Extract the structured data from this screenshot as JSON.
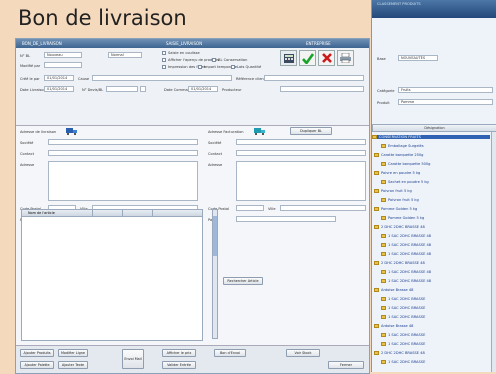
{
  "page": {
    "title": "Bon de livraison"
  },
  "main_window": {
    "title_left": "BON_DE_LIVRAISON",
    "title_mid": "SAISIE_LIVRAISON",
    "title_right": "ENTREPRISE",
    "fields": {
      "num_label": "N° BL",
      "num_value": "Nouveau",
      "modifie_label": "Modifié par",
      "cree_label": "Créé le par",
      "cree_value": "01/01/2014",
      "dateliv_label": "Date Livraison",
      "dateliv_value": "01/01/2014",
      "cause_label": "Cause",
      "num_bl_label": "N° Devis/BL",
      "ref_client_label": "Référence client",
      "date_cmd_label": "Date Commande",
      "date_cmd_value": "01/01/2014",
      "producteur_label": "Producteur",
      "statut_value": "Normal"
    },
    "checkboxes": [
      "Saisie en coulisse",
      "Afficher l'aperçu de produits",
      "BL Conservation",
      "Impression des frites",
      "Import temporaire",
      "Lots Quantité"
    ],
    "tabs": [
      "Entête",
      "Lignes",
      "Pied"
    ],
    "left_section": {
      "heading": "Adresse de livraison",
      "societe": "Société",
      "contact": "Contact",
      "adresse": "Adresse",
      "code_postal": "Code Postal",
      "ville": "Ville",
      "pays": "Pays",
      "sans_impr": "Si impression"
    },
    "right_section": {
      "heading": "Adresse Facturation",
      "button": "Dupliquer BL",
      "societe": "Société",
      "contact": "Contact",
      "adresse": "Adresse",
      "code_postal": "Code Postal",
      "ville": "Ville",
      "pays": "Pays"
    },
    "grid_header": "Nom de l'article",
    "side_button": "Rechercher Article",
    "bottom_buttons": [
      "Ajouter Produits",
      "Modifier Ligne",
      "Ajouter Palette",
      "Ajouter Texte",
      "Envoi Mail",
      "Afficher le prix",
      "Valider Entrée",
      "Bon d'Envoi",
      "Voir Stock",
      "Fermer"
    ],
    "toolbar_icons": [
      "calculator-icon",
      "check-icon",
      "delete-icon",
      "print-icon"
    ],
    "colors": {
      "accent": "#2f62b3",
      "check": "#1aa32a",
      "delete": "#cc1a1a"
    }
  },
  "side_window": {
    "title": "CLASSEMENT PRODUITS",
    "fields": {
      "base_label": "Base",
      "base_value": "NOUVEAUTÉS",
      "categorie_label": "Catégorie",
      "categorie_value": "Fruits",
      "produit_label": "Produit",
      "produit_value": "Pomme"
    },
    "list_header": "Désignation",
    "tree": [
      {
        "label": "CONSERVATION FRUITS",
        "level": 0,
        "selected": true
      },
      {
        "label": "Emballage Surgelés",
        "level": 1
      },
      {
        "label": "Carotte barquette 250g",
        "level": 0
      },
      {
        "label": "Carotte barquette 500g",
        "level": 1
      },
      {
        "label": "Poivre en poudre 5 kg",
        "level": 0
      },
      {
        "label": "Sachet en poudre 5 kg",
        "level": 1
      },
      {
        "label": "Poivron fruit 5 kg",
        "level": 0
      },
      {
        "label": "Poivron fruit 5 kg",
        "level": 1
      },
      {
        "label": "Pomme Golden 5 kg",
        "level": 0
      },
      {
        "label": "Pomme Golden 5 kg",
        "level": 1
      },
      {
        "label": "2 DHC 2DHC BRASSE 48",
        "level": 0
      },
      {
        "label": "1 SAC 2DHC BRASSE 48",
        "level": 1
      },
      {
        "label": "1 SAC 2DHC BRASSE 48",
        "level": 1
      },
      {
        "label": "1 SAC 2DHC BRASSE 48",
        "level": 1
      },
      {
        "label": "2 DHC 2DHC BRASSE 48",
        "level": 0
      },
      {
        "label": "1 SAC 2DHC BRASSE 48",
        "level": 1
      },
      {
        "label": "1 SAC 2DHC BRASSE 48",
        "level": 1
      },
      {
        "label": "Ardoise Brasse 48",
        "level": 0
      },
      {
        "label": "1 SAC 2DHC BRASSE",
        "level": 1
      },
      {
        "label": "1 SAC 2DHC BRASSE",
        "level": 1
      },
      {
        "label": "1 SAC 2DHC BRASSE",
        "level": 1
      },
      {
        "label": "Ardoise Brasse 48",
        "level": 0
      },
      {
        "label": "1 SAC 2DHC BRASSE",
        "level": 1
      },
      {
        "label": "1 SAC 2DHC BRASSE",
        "level": 1
      },
      {
        "label": "2 DHC 2DHC BRASSE 48",
        "level": 0
      },
      {
        "label": "1 SAC 2DHC BRASSE",
        "level": 1
      }
    ]
  }
}
